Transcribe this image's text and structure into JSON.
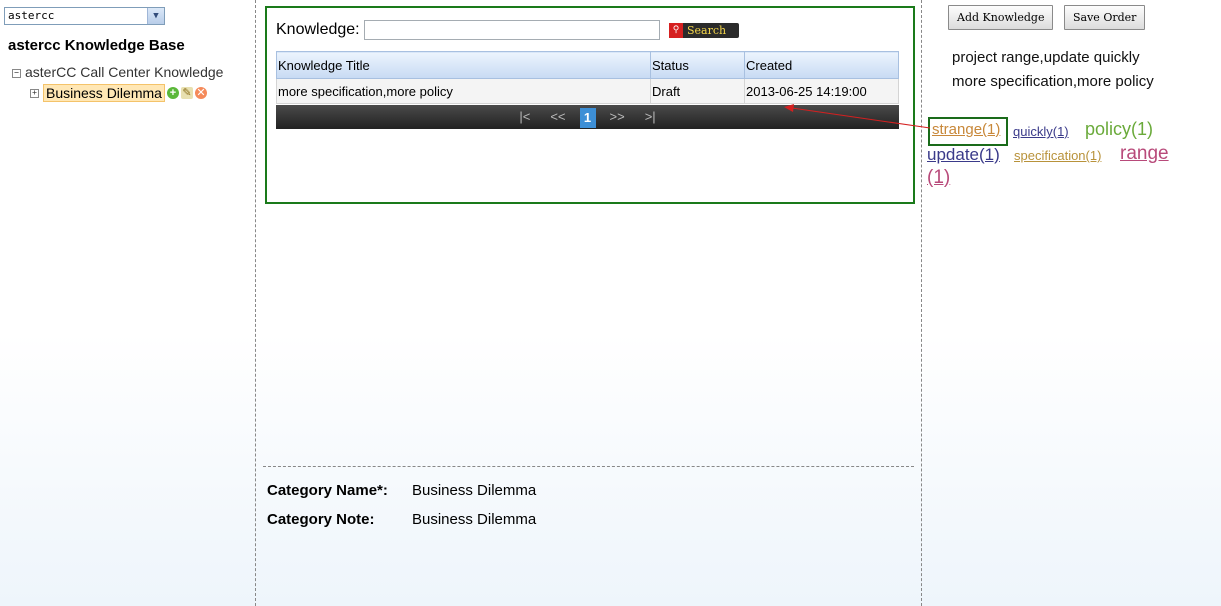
{
  "left": {
    "selector_value": "astercc",
    "kb_title": "astercc Knowledge Base",
    "tree_root_label": "asterCC Call Center Knowledge",
    "tree_child_label": "Business Dilemma"
  },
  "search": {
    "label": "Knowledge:",
    "input_value": "",
    "button_label": "Search"
  },
  "table": {
    "headers": [
      "Knowledge Title",
      "Status",
      "Created"
    ],
    "rows": [
      {
        "title": "more specification,more policy",
        "status": "Draft",
        "created": "2013-06-25 14:19:00"
      }
    ]
  },
  "pager": {
    "first": "|<",
    "prev": "<<",
    "current": "1",
    "next": ">>",
    "last": ">|"
  },
  "category": {
    "name_label": "Category Name*:",
    "name_value": "Business Dilemma",
    "note_label": "Category Note:",
    "note_value": "Business Dilemma"
  },
  "right": {
    "add_button": "Add Knowledge",
    "save_button": "Save Order",
    "summary_line1": "project range,update quickly",
    "summary_line2": "more specification,more policy",
    "tags": [
      {
        "label": "strange(1)",
        "color": "#c8883a"
      },
      {
        "label": "quickly(1)",
        "color": "#3a3a8a"
      },
      {
        "label": "policy(1)",
        "color": "#6aaa3a"
      },
      {
        "label": "update(1)",
        "color": "#3a3a8a"
      },
      {
        "label": "specification(1)",
        "color": "#b8923a"
      },
      {
        "label": "range",
        "color": "#b84a7a"
      },
      {
        "label": "(1)",
        "color": "#b84a7a"
      }
    ]
  },
  "colors": {
    "panel_border": "#1a7a1a",
    "arrow": "#d42020",
    "pager_current": "#3d8fd6"
  }
}
